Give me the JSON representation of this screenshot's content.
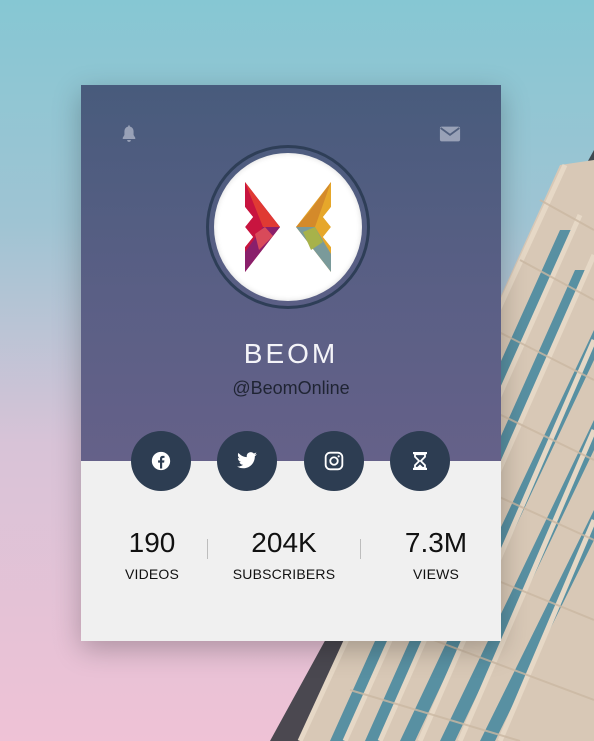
{
  "profile": {
    "name": "BEOM",
    "handle": "@BeomOnline"
  },
  "icons": {
    "notifications": "bell-icon",
    "messages": "envelope-icon"
  },
  "social": [
    {
      "name": "facebook-icon"
    },
    {
      "name": "twitter-icon"
    },
    {
      "name": "instagram-icon"
    },
    {
      "name": "hourglass-icon"
    }
  ],
  "stats": [
    {
      "value": "190",
      "label": "VIDEOS"
    },
    {
      "value": "204K",
      "label": "SUBSCRIBERS"
    },
    {
      "value": "7.3M",
      "label": "VIEWS"
    }
  ],
  "colors": {
    "card_header": "#4f5d80",
    "card_body": "#f0f0f0",
    "social_button": "#2d3d52"
  }
}
